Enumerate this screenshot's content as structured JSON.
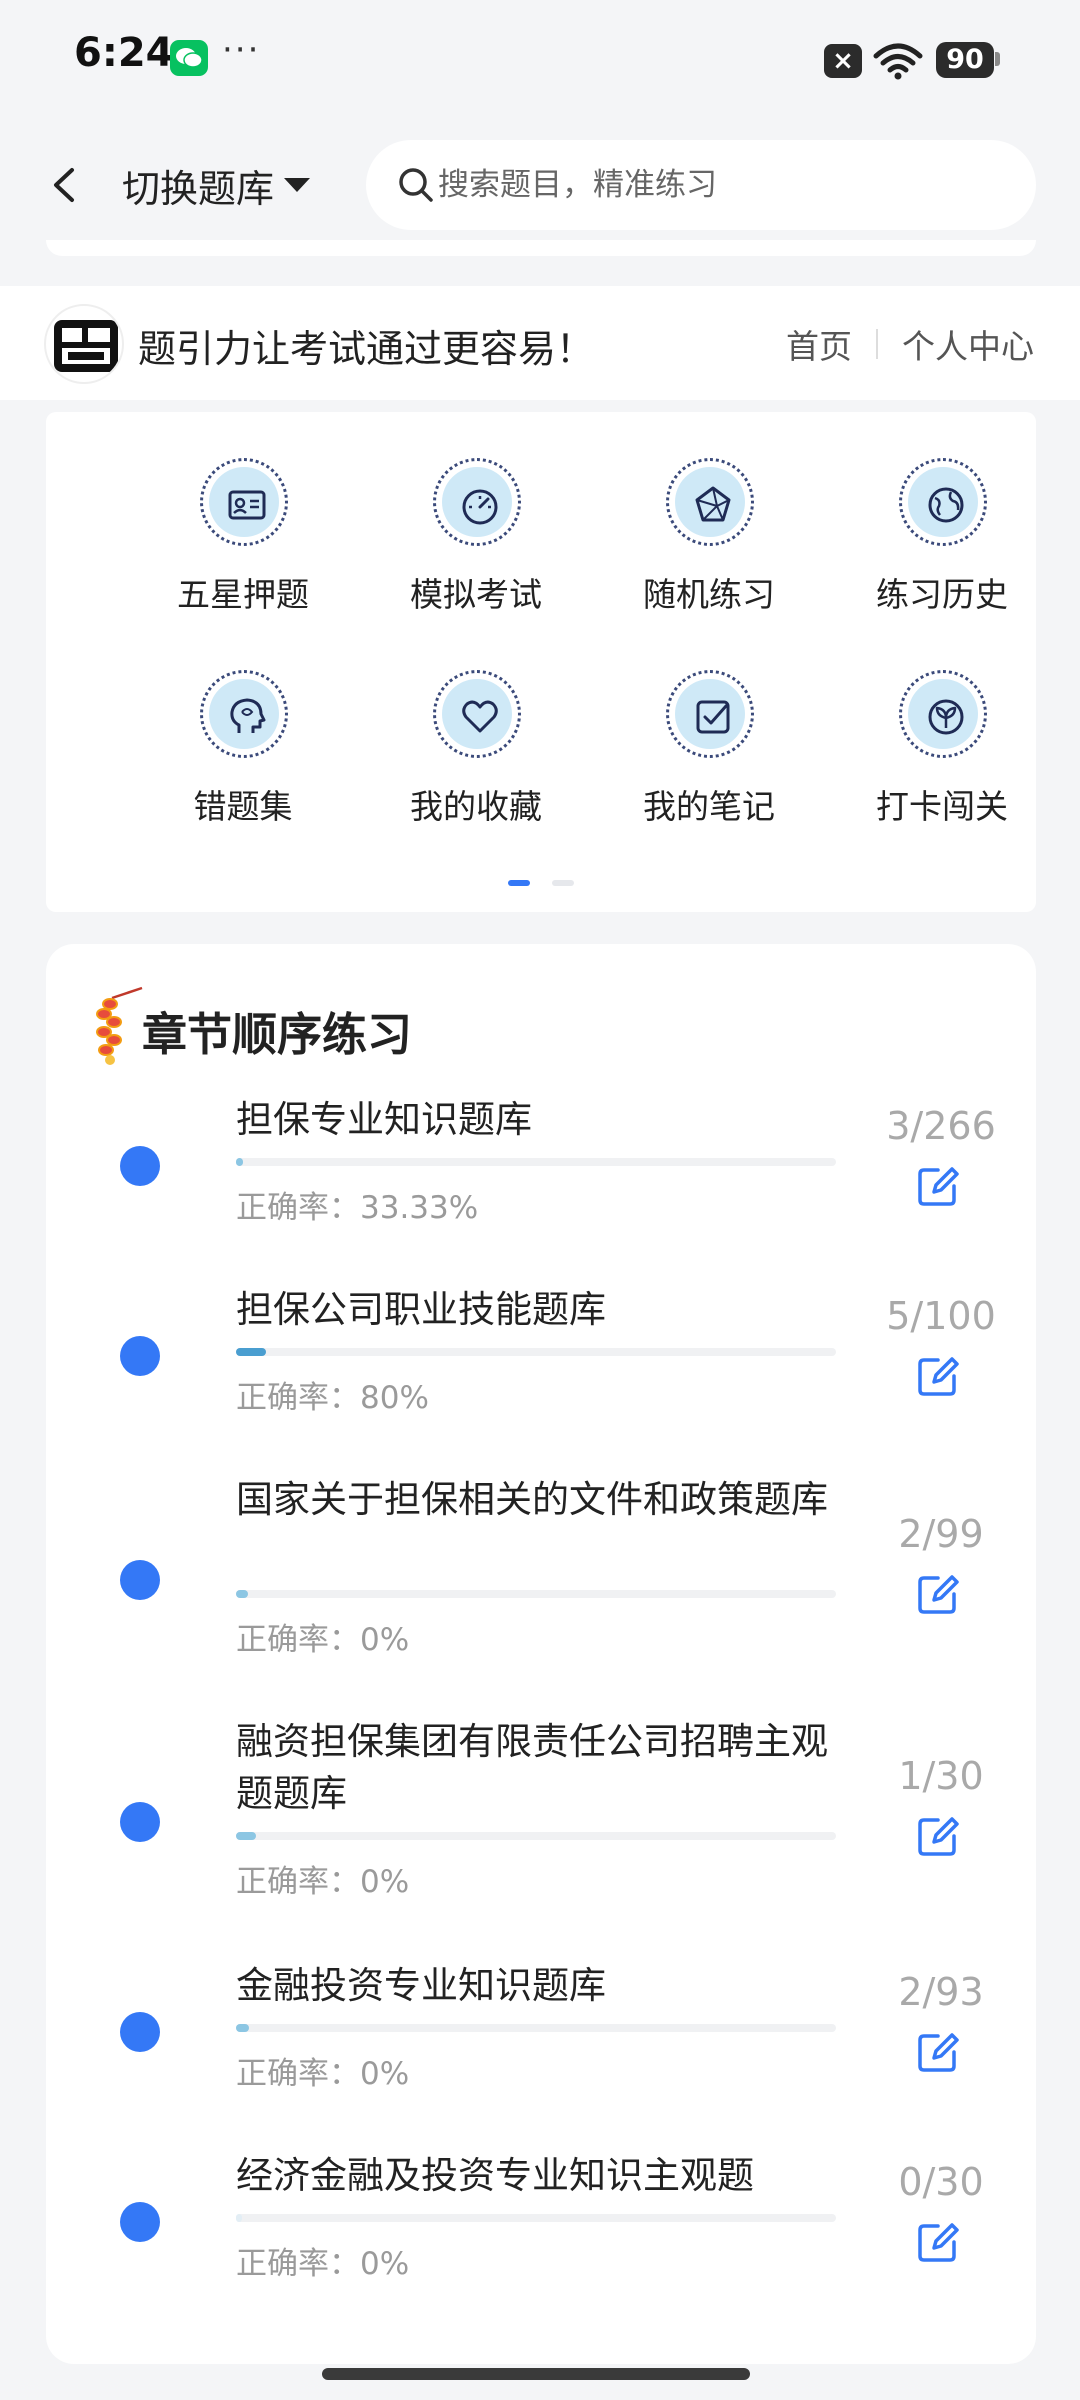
{
  "status_bar": {
    "time": "6:24",
    "dots": "···",
    "battery": "90"
  },
  "header": {
    "switch_label": "切换题库",
    "search_placeholder": "搜索题目，精准练习"
  },
  "brand": {
    "slogan": "题引力让考试通过更容易！",
    "nav": [
      "首页",
      "个人中心"
    ]
  },
  "features": [
    {
      "label": "五星押题",
      "icon": "id-card-icon"
    },
    {
      "label": "模拟考试",
      "icon": "speedometer-icon"
    },
    {
      "label": "随机练习",
      "icon": "polyhedron-icon"
    },
    {
      "label": "练习历史",
      "icon": "globe-icon"
    },
    {
      "label": "错题集",
      "icon": "head-icon"
    },
    {
      "label": "我的收藏",
      "icon": "heart-icon"
    },
    {
      "label": "我的笔记",
      "icon": "checkbox-icon"
    },
    {
      "label": "打卡闯关",
      "icon": "leaf-icon"
    }
  ],
  "colors": {
    "accent": "#3478f6",
    "icon_bg": "#cfe9f7",
    "progress": "#6fb3d6"
  },
  "chapter_section": {
    "title": "章节顺序练习",
    "items": [
      {
        "title": "担保专业知识题库",
        "accuracy": "正确率：33.33%",
        "count": "3/266",
        "progress": 0.011
      },
      {
        "title": "担保公司职业技能题库",
        "accuracy": "正确率：80%",
        "count": "5/100",
        "progress": 0.05
      },
      {
        "title": "国家关于担保相关的文件和政策题库",
        "accuracy": "正确率：0%",
        "count": "2/99",
        "progress": 0.02
      },
      {
        "title": "融资担保集团有限责任公司招聘主观题题库",
        "accuracy": "正确率：0%",
        "count": "1/30",
        "progress": 0.033
      },
      {
        "title": "金融投资专业知识题库",
        "accuracy": "正确率：0%",
        "count": "2/93",
        "progress": 0.022
      },
      {
        "title": "经济金融及投资专业知识主观题",
        "accuracy": "正确率：0%",
        "count": "0/30",
        "progress": 0.0
      }
    ]
  }
}
